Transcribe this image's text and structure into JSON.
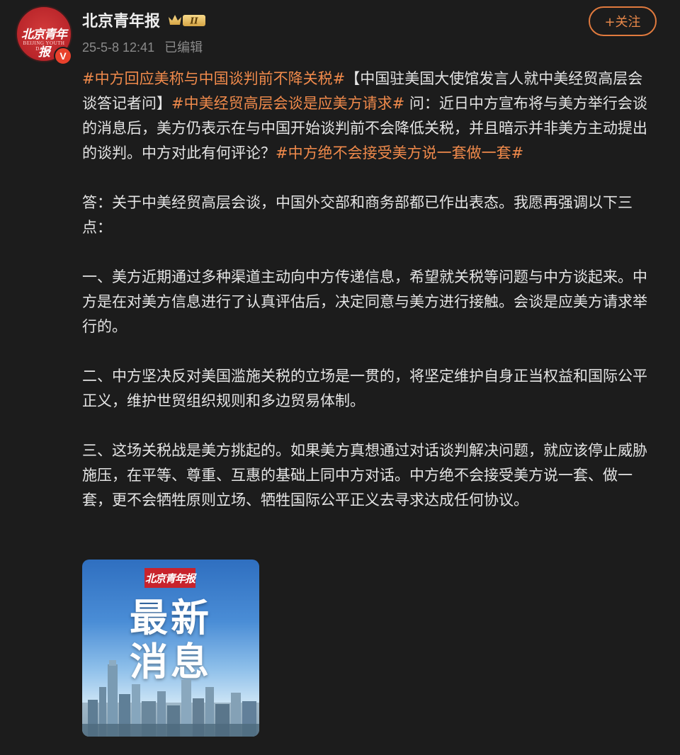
{
  "account": {
    "name": "北京青年报",
    "avatar_text": "北京青年报",
    "avatar_sub": "BEIJING YOUTH DAILY",
    "verified_mark": "V",
    "badge_label": "II"
  },
  "meta": {
    "timestamp": "25-5-8 12:41",
    "edited": "已编辑"
  },
  "follow_button": "+关注",
  "post": {
    "p1": [
      {
        "t": "#中方回应美称与中国谈判前不降关税#",
        "tag": true
      },
      {
        "t": "【中国驻美国大使馆发言人就中美经贸高层会谈答记者问】",
        "tag": false
      },
      {
        "t": "#中美经贸高层会谈是应美方请求#",
        "tag": true
      },
      {
        "t": " 问：近日中方宣布将与美方举行会谈的消息后，美方仍表示在与中国开始谈判前不会降低关税，并且暗示并非美方主动提出的谈判。中方对此有何评论？",
        "tag": false
      },
      {
        "t": "#中方绝不会接受美方说一套做一套#",
        "tag": true
      }
    ],
    "p2": "答：关于中美经贸高层会谈，中国外交部和商务部都已作出表态。我愿再强调以下三点：",
    "p3": "一、美方近期通过多种渠道主动向中方传递信息，希望就关税等问题与中方谈起来。中方是在对美方信息进行了认真评估后，决定同意与美方进行接触。会谈是应美方请求举行的。",
    "p4": "二、中方坚决反对美国滥施关税的立场是一贯的，将坚定维护自身正当权益和国际公平正义，维护世贸组织规则和多边贸易体制。",
    "p5": "三、这场关税战是美方挑起的。如果美方真想通过对话谈判解决问题，就应该停止威胁施压，在平等、尊重、互惠的基础上同中方对话。中方绝不会接受美方说一套、做一套，更不会牺牲原则立场、牺牲国际公平正义去寻求达成任何协议。"
  },
  "image_card": {
    "logo": "北京青年报",
    "title_line1": "最新",
    "title_line2": "消息"
  },
  "colors": {
    "background": "#1c1c1c",
    "hashtag": "#f08a4b",
    "follow_border": "#e07a3e",
    "meta_text": "#8a8a8a"
  }
}
